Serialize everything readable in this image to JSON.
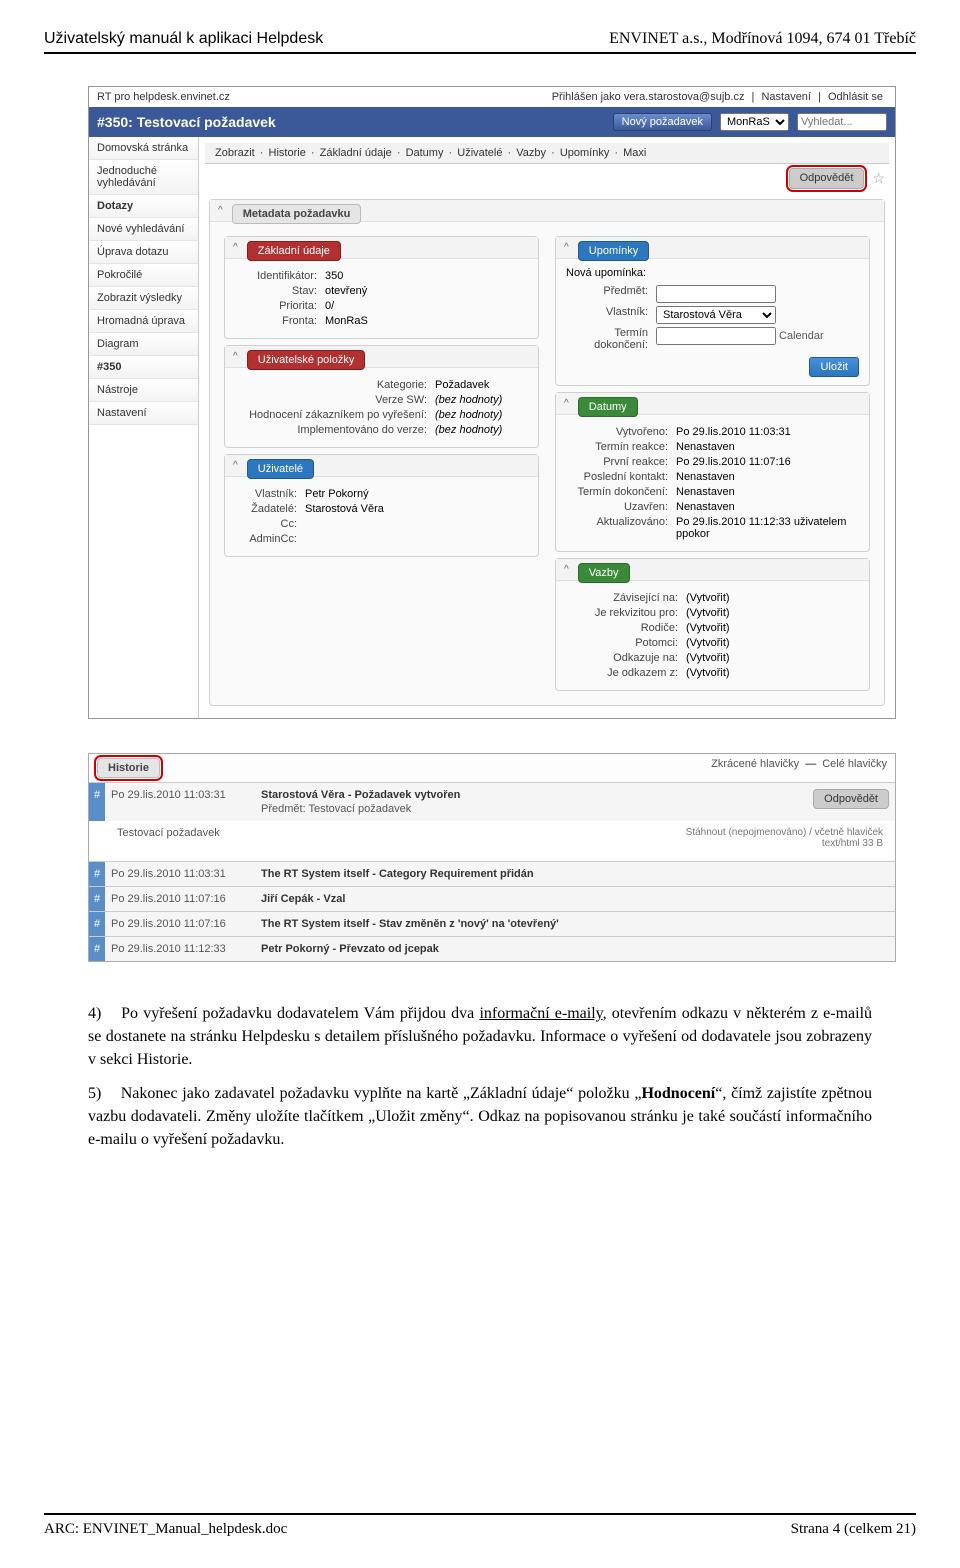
{
  "doc": {
    "header_left": "Uživatelský manuál k aplikaci Helpdesk",
    "header_right": "ENVINET a.s., Modřínová 1094, 674 01 Třebíč",
    "footer_left": "ARC: ENVINET_Manual_helpdesk.doc",
    "footer_right": "Strana 4 (celkem 21)"
  },
  "screenshot": {
    "top_title": "RT pro helpdesk.envinet.cz",
    "login_text": "Přihlášen jako vera.starostova@sujb.cz",
    "nav_settings": "Nastavení",
    "nav_logout": "Odhlásit se",
    "ticket_title": "#350: Testovací požadavek",
    "new_btn": "Nový požadavek",
    "queue_select": "MonRaS",
    "search_placeholder": "Vyhledat...",
    "subnav": [
      "Zobrazit",
      "Historie",
      "Základní údaje",
      "Datumy",
      "Uživatelé",
      "Vazby",
      "Upomínky",
      "Maxi"
    ],
    "sidebar": [
      {
        "label": "Domovská stránka",
        "bold": false
      },
      {
        "label": "Jednoduché vyhledávání",
        "bold": false
      },
      {
        "label": "Dotazy",
        "bold": true
      },
      {
        "label": "Nové vyhledávání",
        "bold": false
      },
      {
        "label": "Úprava dotazu",
        "bold": false
      },
      {
        "label": "Pokročilé",
        "bold": false
      },
      {
        "label": "Zobrazit výsledky",
        "bold": false
      },
      {
        "label": "Hromadná úprava",
        "bold": false
      },
      {
        "label": "Diagram",
        "bold": false
      },
      {
        "label": "#350",
        "bold": true
      },
      {
        "label": "Nástroje",
        "bold": false
      },
      {
        "label": "Nastavení",
        "bold": false
      }
    ],
    "reply_btn": "Odpovědět",
    "star": "☆",
    "meta_panel_title": "Metadata požadavku",
    "basics": {
      "title": "Základní údaje",
      "rows": [
        {
          "k": "Identifikátor:",
          "v": "350"
        },
        {
          "k": "Stav:",
          "v": "otevřený"
        },
        {
          "k": "Priorita:",
          "v": "0/"
        },
        {
          "k": "Fronta:",
          "v": "MonRaS"
        }
      ]
    },
    "custom": {
      "title": "Uživatelské položky",
      "rows": [
        {
          "k": "Kategorie:",
          "v": "Požadavek"
        },
        {
          "k": "Verze SW:",
          "v": "(bez hodnoty)"
        },
        {
          "k": "Hodnocení zákazníkem po vyřešení:",
          "v": "(bez hodnoty)"
        },
        {
          "k": "Implementováno do verze:",
          "v": "(bez hodnoty)"
        }
      ]
    },
    "people": {
      "title": "Uživatelé",
      "rows": [
        {
          "k": "Vlastník:",
          "v": "Petr Pokorný"
        },
        {
          "k": "Žadatelé:",
          "v": "Starostová Věra"
        },
        {
          "k": "Cc:",
          "v": ""
        },
        {
          "k": "AdminCc:",
          "v": ""
        }
      ]
    },
    "reminders": {
      "title": "Upomínky",
      "new_label": "Nová upomínka:",
      "rows": [
        {
          "k": "Předmět:",
          "v": "",
          "input": true
        },
        {
          "k": "Vlastník:",
          "v": "Starostová Věra",
          "select": true
        },
        {
          "k": "Termín dokončení:",
          "v": "",
          "input": true,
          "after": "Calendar"
        }
      ],
      "save": "Uložit"
    },
    "dates": {
      "title": "Datumy",
      "rows": [
        {
          "k": "Vytvořeno:",
          "v": "Po 29.lis.2010 11:03:31"
        },
        {
          "k": "Termín reakce:",
          "v": "Nenastaven"
        },
        {
          "k": "První reakce:",
          "v": "Po 29.lis.2010 11:07:16"
        },
        {
          "k": "Poslední kontakt:",
          "v": "Nenastaven"
        },
        {
          "k": "Termín dokončení:",
          "v": "Nenastaven"
        },
        {
          "k": "Uzavřen:",
          "v": "Nenastaven"
        },
        {
          "k": "Aktualizováno:",
          "v": "Po 29.lis.2010 11:12:33 uživatelem ppokor"
        }
      ]
    },
    "links": {
      "title": "Vazby",
      "rows": [
        {
          "k": "Závisející na:",
          "v": "(Vytvořit)"
        },
        {
          "k": "Je rekvizitou pro:",
          "v": "(Vytvořit)"
        },
        {
          "k": "Rodiče:",
          "v": "(Vytvořit)"
        },
        {
          "k": "Potomci:",
          "v": "(Vytvořit)"
        },
        {
          "k": "Odkazuje na:",
          "v": "(Vytvořit)"
        },
        {
          "k": "Je odkazem z:",
          "v": "(Vytvořit)"
        }
      ]
    },
    "history": {
      "title": "Historie",
      "brief": "Zkrácené hlavičky",
      "full": "Celé hlavičky",
      "reply": "Odpovědět",
      "download": "Stáhnout (nepojmenováno) / včetně hlaviček",
      "mime": "text/html 33 B",
      "entries": [
        {
          "date": "Po 29.lis.2010 11:03:31",
          "title": "Starostová Věra - Požadavek vytvořen",
          "subject": "Předmět: Testovací požadavek",
          "body": "Testovací požadavek",
          "expanded": true
        },
        {
          "date": "Po 29.lis.2010 11:03:31",
          "title": "The RT System itself - Category Requirement přidán"
        },
        {
          "date": "Po 29.lis.2010 11:07:16",
          "title": "Jiří Cepák - Vzal"
        },
        {
          "date": "Po 29.lis.2010 11:07:16",
          "title": "The RT System itself - Stav změněn z 'nový' na 'otevřený'"
        },
        {
          "date": "Po 29.lis.2010 11:12:33",
          "title": "Petr Pokorný - Převzato od jcepak"
        }
      ]
    }
  },
  "paragraphs": {
    "p4": "Po vyřešení požadavku dodavatelem Vám přijdou dva informační e-maily, otevřením odkazu v některém z e-mailů se dostanete na stránku Helpdesku s detailem příslušného požadavku. Informace o vyřešení od dodavatele jsou zobrazeny v sekci Historie.",
    "p5": "Nakonec jako zadavatel požadavku vyplňte na kartě „Základní údaje“ položku „Hodnocení“, čímž zajistíte zpětnou vazbu dodavateli. Změny uložíte tlačítkem „Uložit změny“. Odkaz na popisovanou stránku je také součástí informačního e-mailu o vyřešení požadavku.",
    "n4": "4)",
    "n5": "5)"
  }
}
